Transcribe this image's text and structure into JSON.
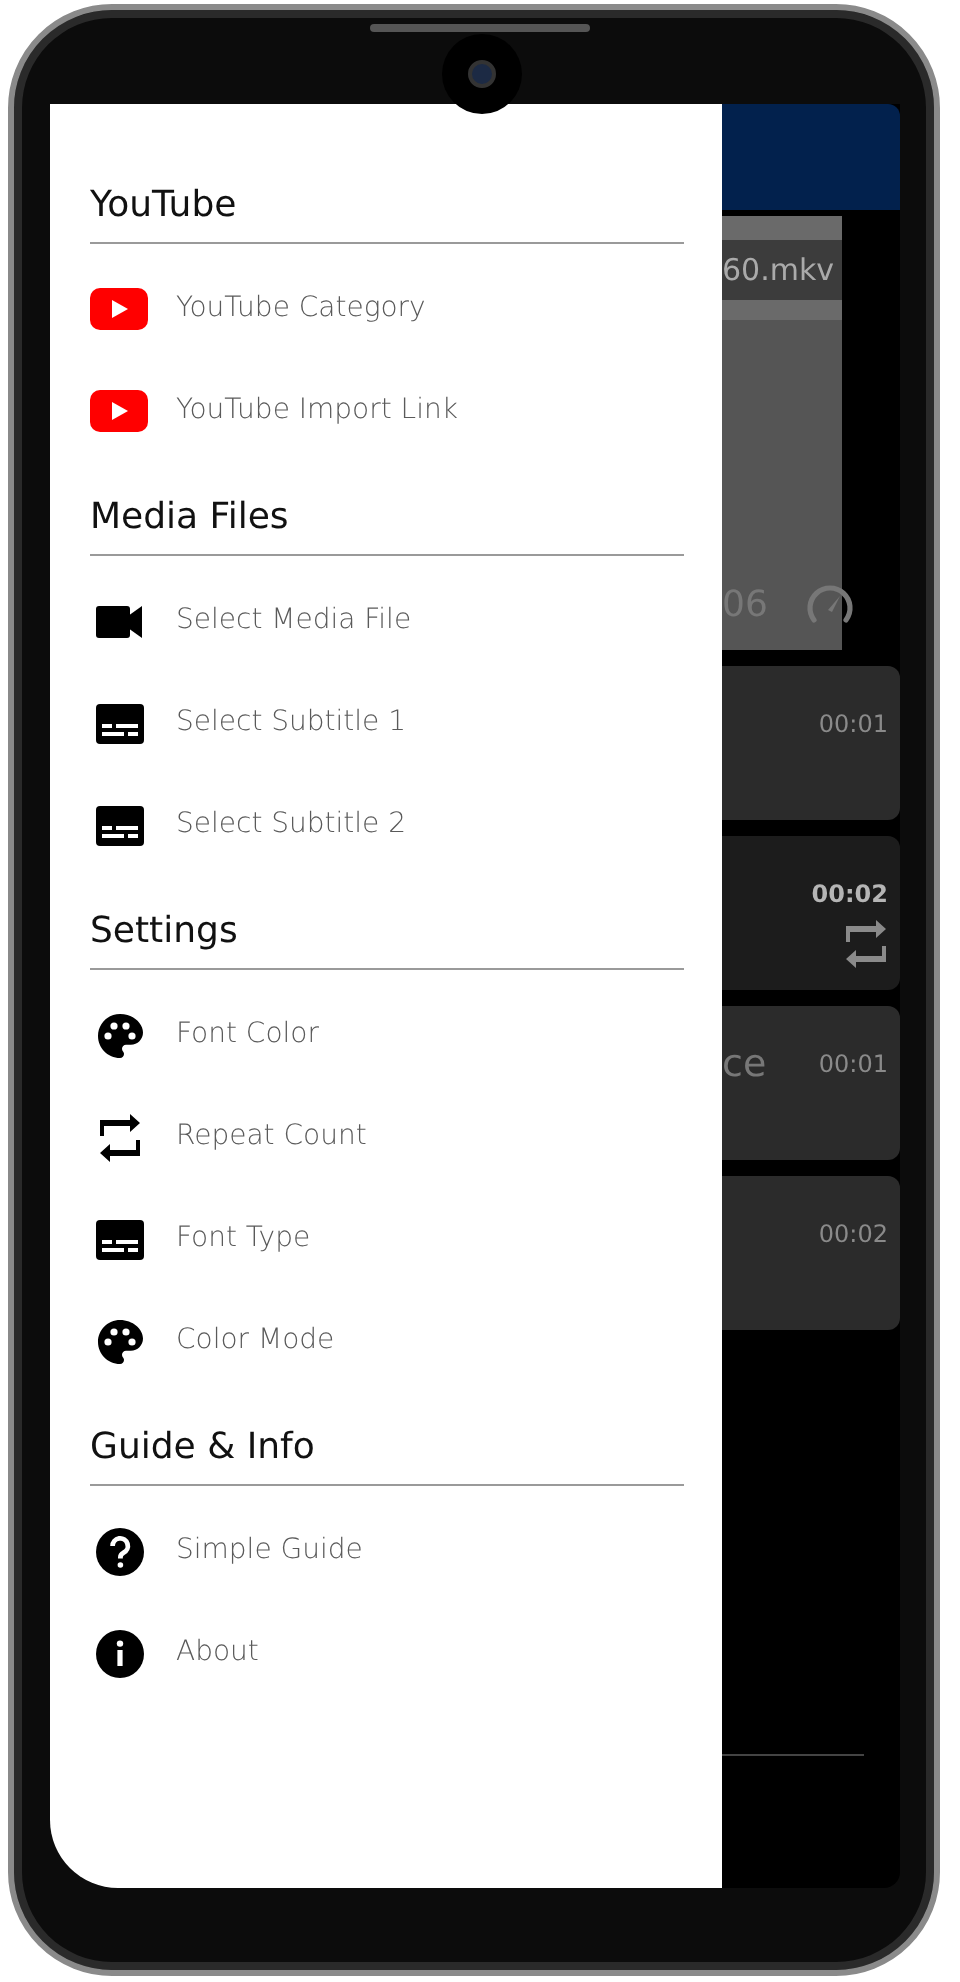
{
  "drawer": {
    "sections": [
      {
        "title": "YouTube",
        "items": [
          {
            "kind": "youtube",
            "label": "YouTube Category"
          },
          {
            "kind": "youtube",
            "label": "YouTube Import Link"
          }
        ]
      },
      {
        "title": "Media Files",
        "items": [
          {
            "kind": "video",
            "label": "Select Media File"
          },
          {
            "kind": "subtitles",
            "label": "Select Subtitle 1"
          },
          {
            "kind": "subtitles",
            "label": "Select Subtitle 2"
          }
        ]
      },
      {
        "title": "Settings",
        "items": [
          {
            "kind": "palette",
            "label": "Font Color"
          },
          {
            "kind": "repeat",
            "label": "Repeat Count"
          },
          {
            "kind": "subtitles",
            "label": "Font Type"
          },
          {
            "kind": "palette",
            "label": "Color Mode"
          }
        ]
      },
      {
        "title": "Guide & Info",
        "items": [
          {
            "kind": "help",
            "label": "Simple Guide"
          },
          {
            "kind": "info",
            "label": "About"
          }
        ]
      }
    ]
  },
  "player": {
    "file_name": "60.mkv",
    "reading": "06"
  },
  "cards": [
    {
      "time": "00:01",
      "selected": false,
      "repeat": false
    },
    {
      "time": "00:02",
      "selected": true,
      "repeat": true
    },
    {
      "time": "00:01",
      "selected": false,
      "repeat": false,
      "text": "ce"
    },
    {
      "time": "00:02",
      "selected": false,
      "repeat": false
    }
  ]
}
